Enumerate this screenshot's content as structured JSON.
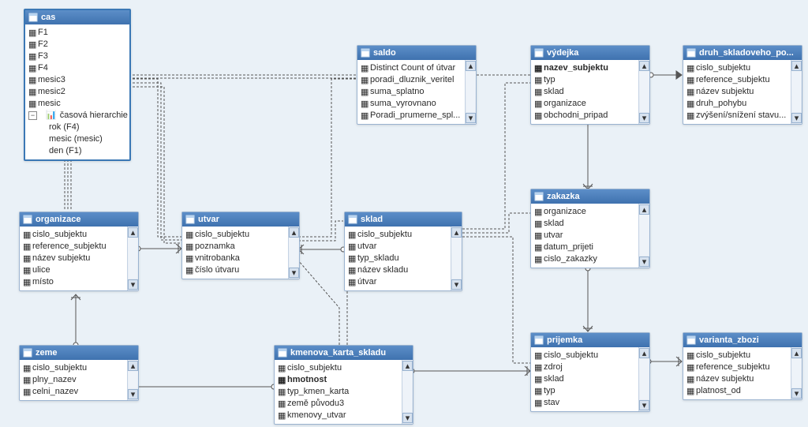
{
  "tables": {
    "cas": {
      "title": "cas",
      "fields": [
        "F1",
        "F2",
        "F3",
        "F4",
        "mesic3",
        "mesic2",
        "mesic"
      ],
      "hierarchy": {
        "label": "časová hierarchie",
        "levels": [
          "rok (F4)",
          "mesic (mesic)",
          "den (F1)"
        ]
      }
    },
    "saldo": {
      "title": "saldo",
      "fields": [
        "Distinct Count of útvar",
        "poradi_dluznik_veritel",
        "suma_splatno",
        "suma_vyrovnano",
        "Poradi_prumerne_spl..."
      ]
    },
    "vydejka": {
      "title": "výdejka",
      "fields": [
        "nazev_subjektu",
        "typ",
        "sklad",
        "organizace",
        "obchodni_pripad"
      ]
    },
    "druh_sklad": {
      "title": "druh_skladoveho_po...",
      "fields": [
        "cislo_subjektu",
        "reference_subjektu",
        "název subjektu",
        "druh_pohybu",
        "zvýšení/snížení stavu..."
      ]
    },
    "organizace": {
      "title": "organizace",
      "fields": [
        "cislo_subjektu",
        "reference_subjektu",
        "název subjektu",
        "ulice",
        "místo"
      ]
    },
    "utvar": {
      "title": "utvar",
      "fields": [
        "cislo_subjektu",
        "poznamka",
        "vnitrobanka",
        "číslo útvaru"
      ]
    },
    "sklad": {
      "title": "sklad",
      "fields": [
        "cislo_subjektu",
        "utvar",
        "typ_skladu",
        "název skladu",
        "útvar"
      ]
    },
    "zakazka": {
      "title": "zakazka",
      "fields": [
        "organizace",
        "sklad",
        "utvar",
        "datum_prijeti",
        "cislo_zakazky"
      ]
    },
    "zeme": {
      "title": "zeme",
      "fields": [
        "cislo_subjektu",
        "plny_nazev",
        "celni_nazev"
      ]
    },
    "kmenova": {
      "title": "kmenova_karta_skladu",
      "fields": [
        "cislo_subjektu",
        "hmotnost",
        "typ_kmen_karta",
        "země původu3",
        "kmenovy_utvar"
      ]
    },
    "prijemka": {
      "title": "prijemka",
      "fields": [
        "cislo_subjektu",
        "zdroj",
        "sklad",
        "typ",
        "stav"
      ]
    },
    "varianta": {
      "title": "varianta_zbozi",
      "fields": [
        "cislo_subjektu",
        "reference_subjektu",
        "název subjektu",
        "platnost_od"
      ]
    }
  }
}
